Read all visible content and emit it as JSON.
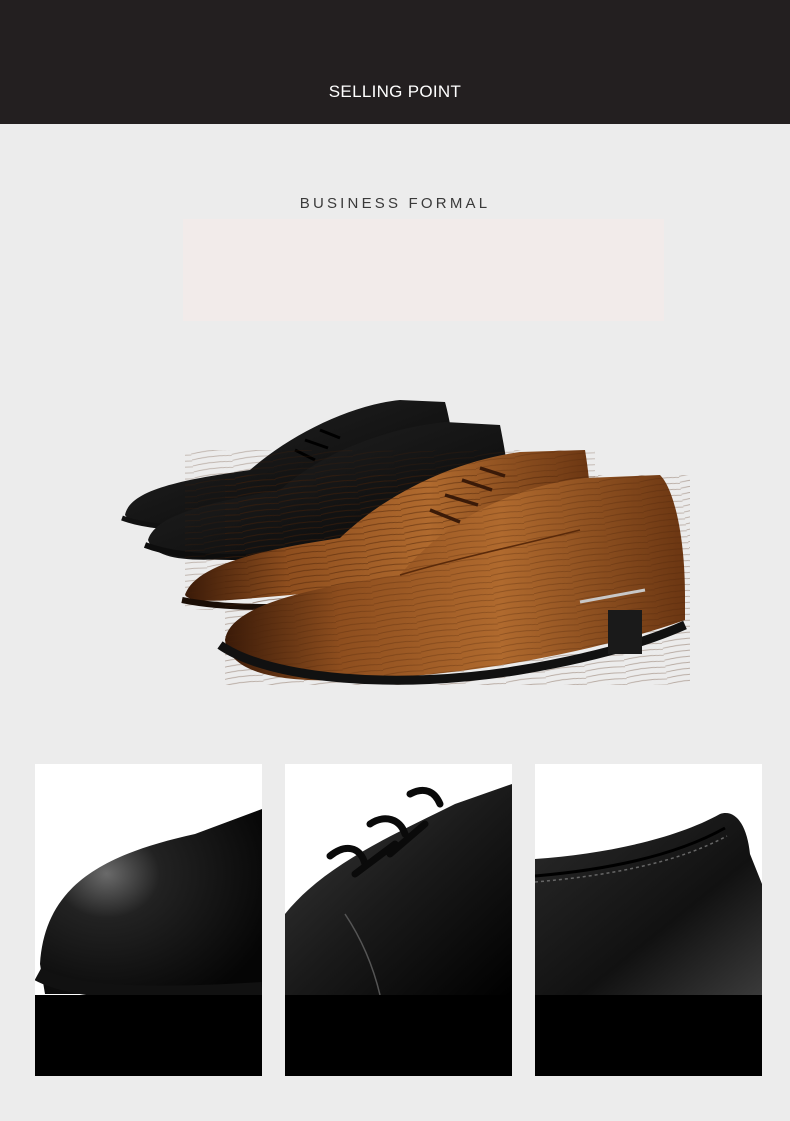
{
  "header": {
    "title": "SELLING POINT"
  },
  "section": {
    "subtitle": "BUSINESS FORMAL"
  },
  "colors": {
    "header_bg": "#231f20",
    "page_bg": "#ececec",
    "leather_brown": "#8a4a1c",
    "leather_black": "#141414"
  },
  "images": {
    "hero": "formal-shoes-hero-image",
    "details": [
      "toe-detail-image",
      "lace-detail-image",
      "heel-collar-detail-image"
    ]
  }
}
